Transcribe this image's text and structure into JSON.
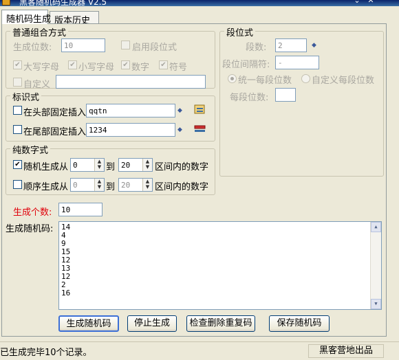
{
  "window": {
    "title": "黑客随机码生成器 V2.5",
    "minimize": "⌄",
    "close": "✕"
  },
  "tabs": [
    {
      "label": "随机码生成"
    },
    {
      "label": "版本历史"
    }
  ],
  "normal": {
    "legend": "普通组合方式",
    "length_label": "生成位数:",
    "length_value": "10",
    "use_segment_label": "启用段位式",
    "uppercase_label": "大写字母",
    "lowercase_label": "小写字母",
    "digits_label": "数字",
    "symbols_label": "符号",
    "custom_label": "自定义",
    "custom_value": ""
  },
  "segment": {
    "legend": "段位式",
    "count_label": "段数:",
    "count_value": "2",
    "separator_label": "段位间隔符:",
    "separator_value": "-",
    "uniform_label": "统一每段位数",
    "custom_label": "自定义每段位数",
    "per_segment_label": "每段位数:",
    "per_segment_value": ""
  },
  "marker": {
    "legend": "标识式",
    "head_label": "在头部固定插入",
    "head_value": "qqtn",
    "tail_label": "在尾部固定插入",
    "tail_value": "1234"
  },
  "numeric": {
    "legend": "纯数字式",
    "random_label": "随机生成从",
    "random_from": "0",
    "random_to": "20",
    "to_label": "到",
    "range_label": "区间内的数字",
    "seq_label": "顺序生成从",
    "seq_from": "0",
    "seq_to": "20"
  },
  "count": {
    "label": "生成个数:",
    "value": "10"
  },
  "output": {
    "label": "生成随机码:",
    "lines": [
      "14",
      "4",
      "9",
      "15",
      "12",
      "13",
      "12",
      "2",
      "16"
    ]
  },
  "buttons": {
    "generate": "生成随机码",
    "stop": "停止生成",
    "dedupe": "检查删除重复码",
    "save": "保存随机码"
  },
  "status": {
    "left": "已生成完毕10个记录。",
    "right": "黑客营地出品"
  },
  "colors": {
    "required_label": "#e0000a",
    "window_bg": "#ece9d8"
  }
}
